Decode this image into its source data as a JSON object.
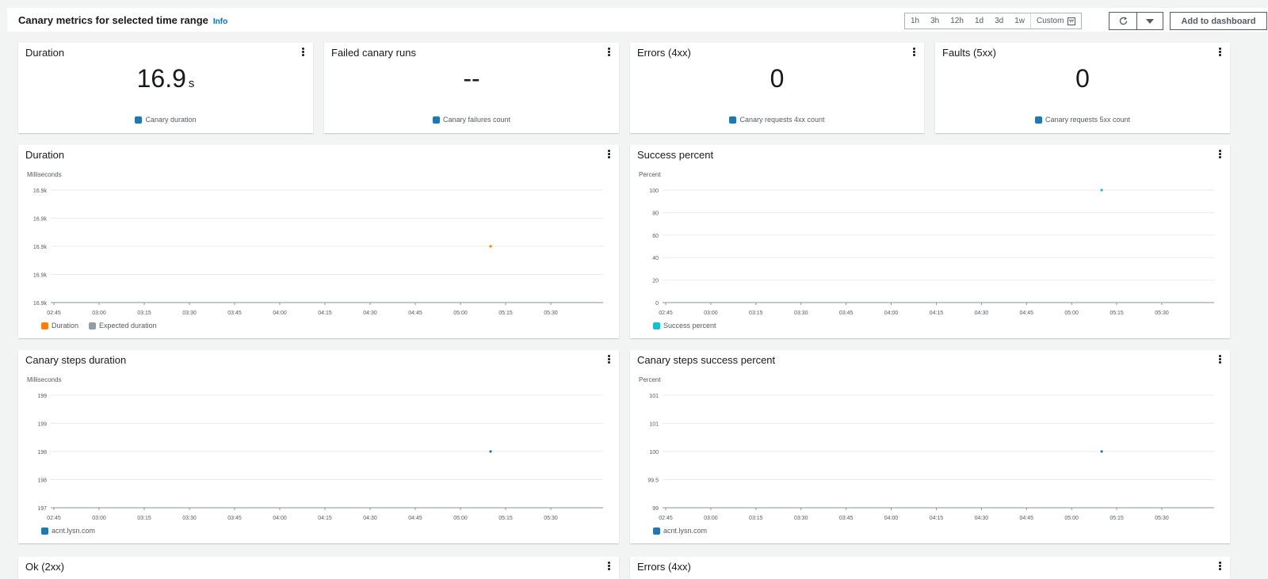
{
  "header": {
    "title": "Canary metrics for selected time range",
    "info": "Info",
    "ranges": [
      "1h",
      "3h",
      "12h",
      "1d",
      "3d",
      "1w"
    ],
    "custom": "Custom",
    "add_label": "Add to dashboard"
  },
  "stats": [
    {
      "title": "Duration",
      "value": "16.9",
      "unit": "s",
      "legend": "Canary duration",
      "color": "#1f77b4"
    },
    {
      "title": "Failed canary runs",
      "value": "--",
      "unit": "",
      "legend": "Canary failures count",
      "color": "#1f77b4"
    },
    {
      "title": "Errors (4xx)",
      "value": "0",
      "unit": "",
      "legend": "Canary requests 4xx count",
      "color": "#1f77b4"
    },
    {
      "title": "Faults (5xx)",
      "value": "0",
      "unit": "",
      "legend": "Canary requests 5xx count",
      "color": "#1f77b4"
    }
  ],
  "bottom_titles": [
    "Ok (2xx)",
    "Errors (4xx)"
  ],
  "chart_data": [
    {
      "type": "scatter",
      "title": "Duration",
      "ylabel": "Milliseconds",
      "x_ticks": [
        "02:45",
        "03:00",
        "03:15",
        "03:30",
        "03:45",
        "04:00",
        "04:15",
        "04:30",
        "04:45",
        "05:00",
        "05:15",
        "05:30"
      ],
      "y_ticks": [
        "16.9k",
        "16.9k",
        "16.9k",
        "16.9k",
        "16.9k"
      ],
      "series": [
        {
          "name": "Duration",
          "color": "#ff7f0e",
          "points": [
            {
              "x": "05:10",
              "y": "16.9k"
            }
          ]
        },
        {
          "name": "Expected duration",
          "color": "#949da6",
          "points": []
        }
      ]
    },
    {
      "type": "scatter",
      "title": "Success percent",
      "ylabel": "Percent",
      "x_ticks": [
        "02:45",
        "03:00",
        "03:15",
        "03:30",
        "03:45",
        "04:00",
        "04:15",
        "04:30",
        "04:45",
        "05:00",
        "05:15",
        "05:30"
      ],
      "y_ticks": [
        "100",
        "80",
        "60",
        "40",
        "20",
        "0"
      ],
      "ylim": [
        0,
        100
      ],
      "series": [
        {
          "name": "Success percent",
          "color": "#17becf",
          "points": [
            {
              "x": "05:10",
              "y": 100
            }
          ]
        }
      ]
    },
    {
      "type": "scatter",
      "title": "Canary steps duration",
      "ylabel": "Milliseconds",
      "x_ticks": [
        "02:45",
        "03:00",
        "03:15",
        "03:30",
        "03:45",
        "04:00",
        "04:15",
        "04:30",
        "04:45",
        "05:00",
        "05:15",
        "05:30"
      ],
      "y_ticks": [
        "199",
        "199",
        "198",
        "198",
        "197"
      ],
      "series": [
        {
          "name": "acnt.lysn.com",
          "color": "#1f77b4",
          "points": [
            {
              "x": "05:10",
              "y": 198
            }
          ]
        }
      ]
    },
    {
      "type": "scatter",
      "title": "Canary steps success percent",
      "ylabel": "Percent",
      "x_ticks": [
        "02:45",
        "03:00",
        "03:15",
        "03:30",
        "03:45",
        "04:00",
        "04:15",
        "04:30",
        "04:45",
        "05:00",
        "05:15",
        "05:30"
      ],
      "y_ticks": [
        "101",
        "101",
        "100",
        "99.5",
        "99"
      ],
      "series": [
        {
          "name": "acnt.lysn.com",
          "color": "#1f77b4",
          "points": [
            {
              "x": "05:10",
              "y": 100
            }
          ]
        }
      ]
    }
  ]
}
